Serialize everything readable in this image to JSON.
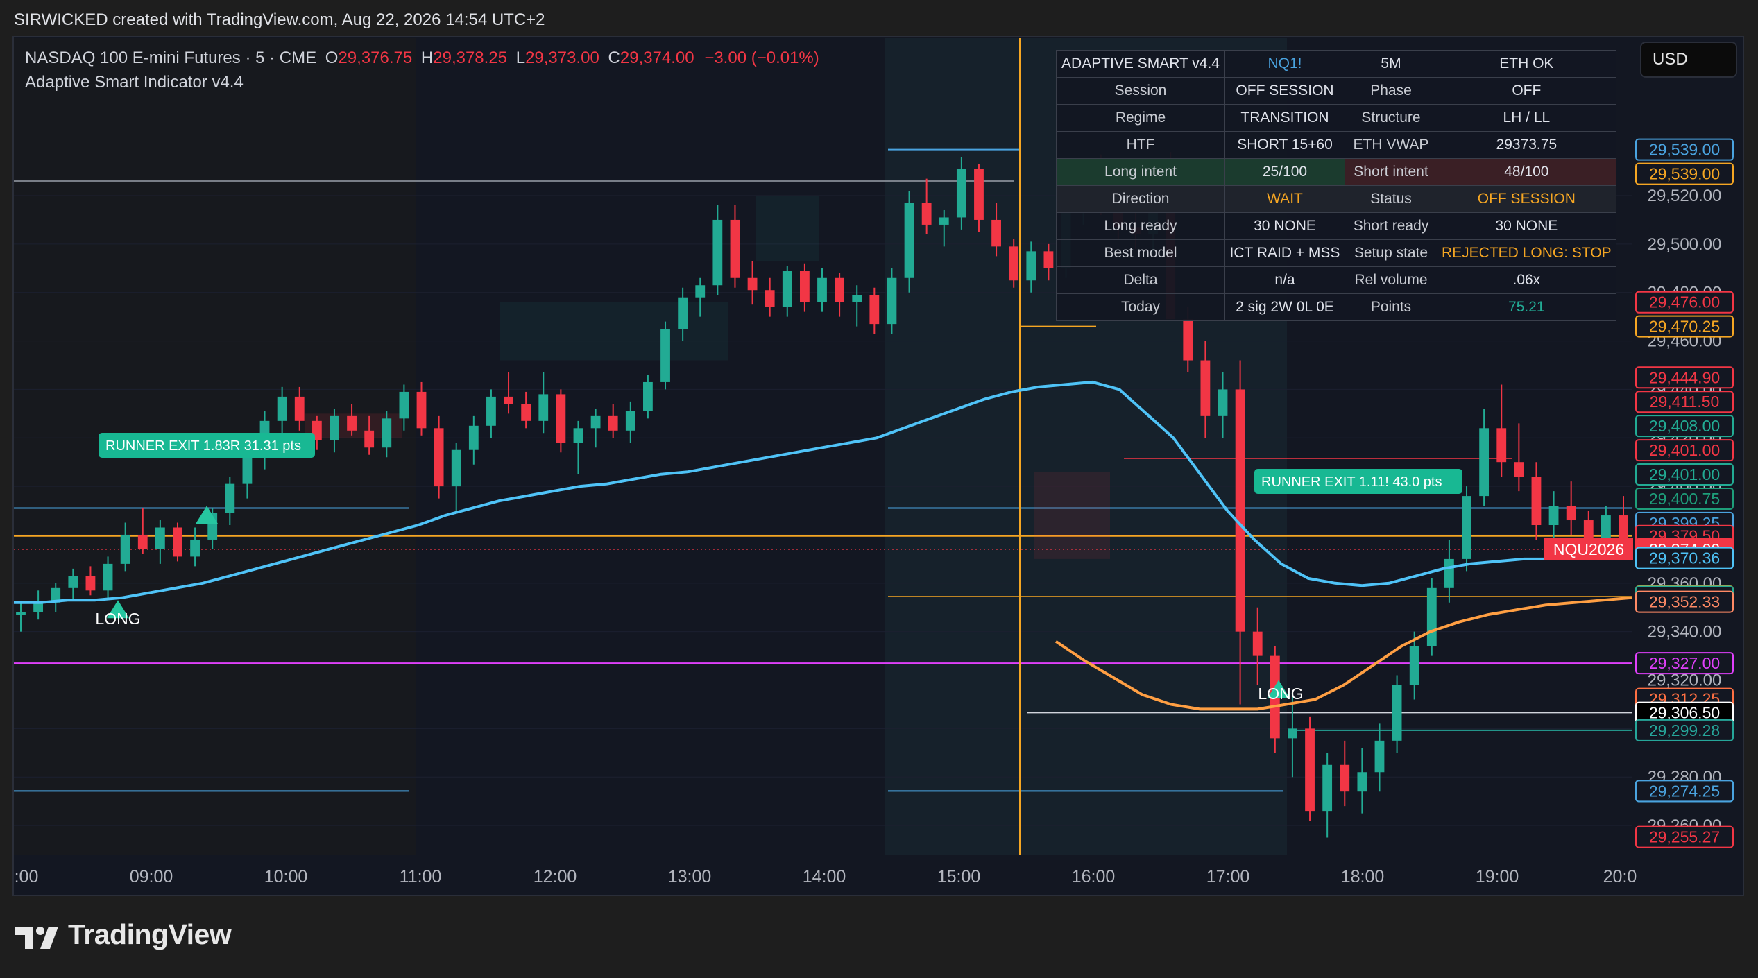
{
  "top_banner": "SIRWICKED created with TradingView.com, Aug 22, 2026 14:54 UTC+2",
  "header": {
    "symbol": "NASDAQ 100 E-mini Futures · 5 · CME",
    "o_label": "O",
    "o": "29,376.75",
    "h_label": "H",
    "h": "29,378.25",
    "l_label": "L",
    "l": "29,373.00",
    "c_label": "C",
    "c": "29,374.00",
    "change": "−3.00 (−0.01%)",
    "indicator": "Adaptive Smart Indicator v4.4"
  },
  "currency": "USD",
  "brand": "TradingView",
  "colors": {
    "up": "#22ab94",
    "down": "#f23645",
    "vwap": "#4fc3f7",
    "eth_vwap": "#ff9f43",
    "bg": "#131722",
    "accent_gold": "#f5a623"
  },
  "info_table": {
    "title": "ADAPTIVE SMART v4.4",
    "symbol": "NQ1!",
    "timeframe": "5M",
    "eth": "ETH OK",
    "rows": [
      {
        "k1": "Session",
        "v1": "OFF SESSION",
        "k2": "Phase",
        "v2": "OFF"
      },
      {
        "k1": "Regime",
        "v1": "TRANSITION",
        "k2": "Structure",
        "v2": "LH / LL"
      },
      {
        "k1": "HTF",
        "v1": "SHORT 15+60",
        "k2": "ETH VWAP",
        "v2": "29373.75"
      },
      {
        "k1": "Long intent",
        "v1": "25/100",
        "k2": "Short intent",
        "v2": "48/100"
      },
      {
        "k1": "Direction",
        "v1": "WAIT",
        "k2": "Status",
        "v2": "OFF SESSION"
      },
      {
        "k1": "Long ready",
        "v1": "30  NONE",
        "k2": "Short ready",
        "v2": "30  NONE"
      },
      {
        "k1": "Best model",
        "v1": "ICT RAID + MSS",
        "k2": "Setup state",
        "v2": "REJECTED LONG: STOP"
      },
      {
        "k1": "Delta",
        "v1": "n/a",
        "k2": "Rel volume",
        "v2": ".06x"
      },
      {
        "k1": "Today",
        "v1": "2 sig  2W 0L 0E",
        "k2": "Points",
        "v2": "75.21"
      }
    ]
  },
  "annotations": {
    "runner1": "RUNNER EXIT  1.83R  31.31 pts",
    "runner2": "RUNNER EXIT  1.11!  43.0 pts",
    "long1": "LONG",
    "long2": "LONG",
    "contract_label": "NQU2026"
  },
  "chart_data": {
    "type": "candlestick",
    "x_ticks": [
      ":00",
      "09:00",
      "10:00",
      "11:00",
      "12:00",
      "13:00",
      "14:00",
      "15:00",
      "16:00",
      "17:00",
      "18:00",
      "19:00",
      "20:0"
    ],
    "y_ticks": [
      "29,520.00",
      "29,500.00",
      "29,480.00",
      "29,460.00",
      "29,440.00",
      "29,420.00",
      "29,400.00",
      "29,380.00",
      "29,360.00",
      "29,340.00",
      "29,320.00",
      "29,300.00",
      "29,280.00",
      "29,260.00"
    ],
    "ylim": [
      29248,
      29585
    ],
    "price_labels": [
      {
        "value": 29539.0,
        "text": "29,539.00",
        "color": "#4aa3df",
        "style": "outline"
      },
      {
        "value": 29529.0,
        "text": "29,539.00",
        "color": "#f5a623",
        "style": "outline"
      },
      {
        "value": 29476.0,
        "text": "29,476.00",
        "color": "#f23645",
        "style": "outline"
      },
      {
        "value": 29466.0,
        "text": "29,470.25",
        "color": "#f5a623",
        "style": "outline"
      },
      {
        "value": 29444.9,
        "text": "29,444.90",
        "color": "#f23645",
        "style": "outline"
      },
      {
        "value": 29434.9,
        "text": "29,411.50",
        "color": "#f23645",
        "style": "outline"
      },
      {
        "value": 29424.9,
        "text": "29,408.00",
        "color": "#22ab94",
        "style": "outline"
      },
      {
        "value": 29414.9,
        "text": "29,401.00",
        "color": "#f23645",
        "style": "outline"
      },
      {
        "value": 29404.9,
        "text": "29,401.00",
        "color": "#22ab94",
        "style": "outline"
      },
      {
        "value": 29394.9,
        "text": "29,400.75",
        "color": "#1e9e7a",
        "style": "outline"
      },
      {
        "value": 29384.9,
        "text": "29,399.25",
        "color": "#4aa3df",
        "style": "outline"
      },
      {
        "value": 29379.5,
        "text": "29,379.50",
        "color": "#f23645",
        "style": "outline"
      },
      {
        "value": 29374.0,
        "text": "29,374.00",
        "color": "#f23645",
        "style": "filled"
      },
      {
        "value": 29370.36,
        "text": "29,370.36",
        "color": "#4fc3f7",
        "style": "outline"
      },
      {
        "value": 29354.5,
        "text": "29,354.50",
        "color": "#f5a623",
        "style": "outline"
      },
      {
        "value": 29354.38,
        "text": "29,354.38",
        "color": "#22ab94",
        "style": "outline"
      },
      {
        "value": 29352.33,
        "text": "29,352.33",
        "color": "#ff8a65",
        "style": "outline"
      },
      {
        "value": 29327.0,
        "text": "29,327.00",
        "color": "#e040fb",
        "style": "outline"
      },
      {
        "value": 29312.25,
        "text": "29,312.25",
        "color": "#ff7043",
        "style": "outline"
      },
      {
        "value": 29306.5,
        "text": "29,306.50",
        "color": "#ffffff",
        "style": "outline-white"
      },
      {
        "value": 29299.28,
        "text": "29,299.28",
        "color": "#26a69a",
        "style": "outline"
      },
      {
        "value": 29274.25,
        "text": "29,274.25",
        "color": "#22ab94",
        "style": "outline"
      },
      {
        "value": 29274.25,
        "text": "29,274.25",
        "color": "#4aa3df",
        "style": "outline"
      },
      {
        "value": 29274.25,
        "text": "29,274.25",
        "color": "#4aa3df",
        "style": "outline"
      },
      {
        "value": 29255.27,
        "text": "29,255.27",
        "color": "#f23645",
        "style": "outline"
      }
    ],
    "vwap": [
      29352,
      29352,
      29353,
      29353,
      29354,
      29356,
      29358,
      29360,
      29363,
      29366,
      29369,
      29372,
      29375,
      29378,
      29381,
      29384,
      29388,
      29391,
      29394,
      29396,
      29398,
      29400,
      29401,
      29403,
      29405,
      29406,
      29408,
      29410,
      29412,
      29414,
      29416,
      29418,
      29420,
      29424,
      29428,
      29432,
      29436,
      29439,
      29441,
      29442,
      29443,
      29440,
      29430,
      29420,
      29405,
      29390,
      29378,
      29368,
      29362,
      29360,
      29359,
      29360,
      29363,
      29366,
      29368,
      29369,
      29370,
      29370,
      29370,
      29370,
      29370
    ],
    "eth_vwap": [
      29336,
      29328,
      29321,
      29314,
      29310,
      29308,
      29308,
      29308,
      29310,
      29312,
      29318,
      29326,
      29334,
      29340,
      29344,
      29347,
      29349,
      29351,
      29352,
      29353,
      29354
    ],
    "candles": [
      [
        29347,
        29352,
        29340,
        29348
      ],
      [
        29348,
        29357,
        29345,
        29352
      ],
      [
        29352,
        29360,
        29348,
        29358
      ],
      [
        29358,
        29366,
        29353,
        29363
      ],
      [
        29363,
        29367,
        29355,
        29357
      ],
      [
        29357,
        29371,
        29354,
        29368
      ],
      [
        29368,
        29385,
        29365,
        29380
      ],
      [
        29380,
        29391,
        29372,
        29374
      ],
      [
        29374,
        29386,
        29368,
        29383
      ],
      [
        29383,
        29385,
        29369,
        29371
      ],
      [
        29371,
        29383,
        29367,
        29378
      ],
      [
        29378,
        29391,
        29374,
        29389
      ],
      [
        29389,
        29404,
        29384,
        29401
      ],
      [
        29401,
        29416,
        29395,
        29412
      ],
      [
        29412,
        29431,
        29407,
        29427
      ],
      [
        29427,
        29441,
        29418,
        29437
      ],
      [
        29437,
        29441,
        29423,
        29427
      ],
      [
        29427,
        29429,
        29415,
        29419
      ],
      [
        29419,
        29432,
        29414,
        29429
      ],
      [
        29429,
        29434,
        29421,
        29423
      ],
      [
        29423,
        29429,
        29413,
        29416
      ],
      [
        29416,
        29431,
        29412,
        29428
      ],
      [
        29428,
        29442,
        29423,
        29439
      ],
      [
        29439,
        29443,
        29421,
        29424
      ],
      [
        29424,
        29429,
        29395,
        29400
      ],
      [
        29400,
        29418,
        29389,
        29415
      ],
      [
        29415,
        29429,
        29409,
        29425
      ],
      [
        29425,
        29440,
        29420,
        29437
      ],
      [
        29437,
        29447,
        29430,
        29434
      ],
      [
        29434,
        29439,
        29424,
        29427
      ],
      [
        29427,
        29447,
        29422,
        29438
      ],
      [
        29438,
        29440,
        29414,
        29418
      ],
      [
        29418,
        29427,
        29405,
        29424
      ],
      [
        29424,
        29432,
        29416,
        29429
      ],
      [
        29429,
        29434,
        29420,
        29423
      ],
      [
        29423,
        29435,
        29418,
        29431
      ],
      [
        29431,
        29446,
        29428,
        29443
      ],
      [
        29443,
        29468,
        29440,
        29465
      ],
      [
        29465,
        29482,
        29460,
        29478
      ],
      [
        29478,
        29486,
        29470,
        29483
      ],
      [
        29483,
        29516,
        29479,
        29510
      ],
      [
        29510,
        29516,
        29482,
        29486
      ],
      [
        29486,
        29493,
        29475,
        29481
      ],
      [
        29481,
        29486,
        29470,
        29474
      ],
      [
        29474,
        29491,
        29470,
        29489
      ],
      [
        29489,
        29492,
        29472,
        29476
      ],
      [
        29476,
        29490,
        29472,
        29486
      ],
      [
        29486,
        29488,
        29470,
        29476
      ],
      [
        29476,
        29483,
        29466,
        29479
      ],
      [
        29479,
        29482,
        29463,
        29467
      ],
      [
        29467,
        29490,
        29463,
        29486
      ],
      [
        29486,
        29522,
        29480,
        29517
      ],
      [
        29517,
        29527,
        29504,
        29508
      ],
      [
        29508,
        29514,
        29499,
        29511
      ],
      [
        29511,
        29536,
        29506,
        29531
      ],
      [
        29531,
        29533,
        29505,
        29510
      ],
      [
        29510,
        29517,
        29495,
        29499
      ],
      [
        29499,
        29502,
        29482,
        29485
      ],
      [
        29485,
        29501,
        29480,
        29497
      ],
      [
        29497,
        29500,
        29485,
        29490
      ],
      [
        29490,
        29515,
        29486,
        29513
      ],
      [
        29513,
        29531,
        29508,
        29527
      ],
      [
        29527,
        29537,
        29512,
        29515
      ],
      [
        29515,
        29524,
        29502,
        29507
      ],
      [
        29507,
        29515,
        29498,
        29504
      ],
      [
        29504,
        29533,
        29496,
        29529
      ],
      [
        29529,
        29538,
        29505,
        29469
      ],
      [
        29469,
        29474,
        29447,
        29452
      ],
      [
        29452,
        29460,
        29420,
        29429
      ],
      [
        29429,
        29447,
        29420,
        29440
      ],
      [
        29440,
        29452,
        29310,
        29340
      ],
      [
        29340,
        29350,
        29318,
        29330
      ],
      [
        29330,
        29334,
        29290,
        29296
      ],
      [
        29296,
        29315,
        29280,
        29300
      ],
      [
        29300,
        29305,
        29262,
        29266
      ],
      [
        29266,
        29290,
        29255,
        29285
      ],
      [
        29285,
        29295,
        29268,
        29274
      ],
      [
        29274,
        29292,
        29265,
        29282
      ],
      [
        29282,
        29302,
        29274,
        29295
      ],
      [
        29295,
        29322,
        29290,
        29318
      ],
      [
        29318,
        29340,
        29312,
        29334
      ],
      [
        29334,
        29362,
        29330,
        29358
      ],
      [
        29358,
        29378,
        29352,
        29370
      ],
      [
        29370,
        29400,
        29365,
        29396
      ],
      [
        29396,
        29432,
        29392,
        29424
      ],
      [
        29424,
        29442,
        29404,
        29410
      ],
      [
        29410,
        29426,
        29398,
        29404
      ],
      [
        29404,
        29410,
        29378,
        29384
      ],
      [
        29384,
        29398,
        29376,
        29392
      ],
      [
        29392,
        29402,
        29380,
        29386
      ],
      [
        29386,
        29390,
        29371,
        29376
      ],
      [
        29376,
        29392,
        29372,
        29388
      ],
      [
        29388,
        29396,
        29373,
        29374
      ]
    ]
  }
}
